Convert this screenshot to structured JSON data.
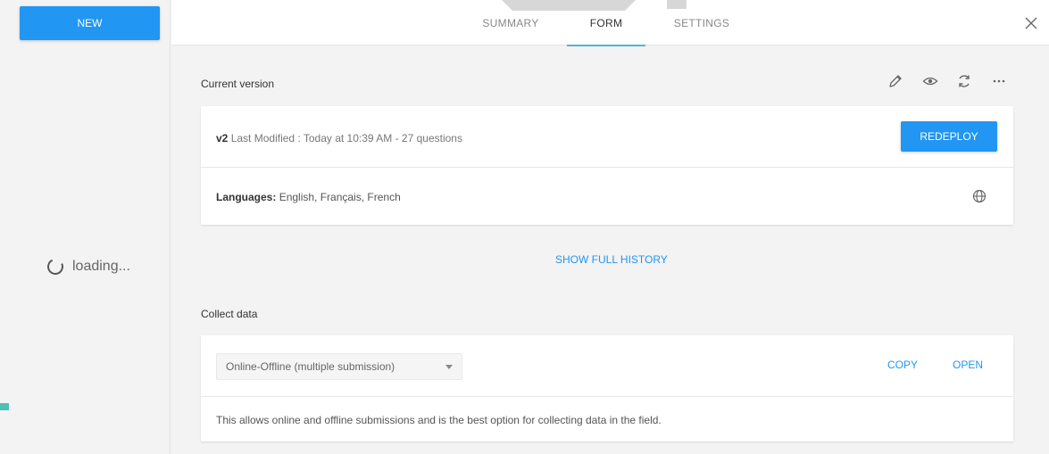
{
  "sidebar": {
    "new_label": "NEW",
    "loading_text": "loading..."
  },
  "tabs": [
    {
      "label": "SUMMARY"
    },
    {
      "label": "FORM",
      "active": true
    },
    {
      "label": "SETTINGS"
    }
  ],
  "current_version": {
    "title": "Current version",
    "version": "v2",
    "meta": "Last Modified : Today at 10:39 AM - 27 questions",
    "redeploy_label": "REDEPLOY",
    "languages_label": "Languages:",
    "languages_value": "English, Français, French",
    "icons": [
      "pencil-icon",
      "eye-icon",
      "refresh-icon",
      "more-icon"
    ]
  },
  "history_link": "SHOW FULL HISTORY",
  "collect_data": {
    "title": "Collect data",
    "select_value": "Online-Offline (multiple submission)",
    "copy_label": "COPY",
    "open_label": "OPEN",
    "description": "This allows online and offline submissions and is the best option for collecting data in the field."
  },
  "colors": {
    "primary": "#2196f3",
    "tab_underline": "#4fb3d9",
    "accent_teal": "#4dc0b5"
  }
}
